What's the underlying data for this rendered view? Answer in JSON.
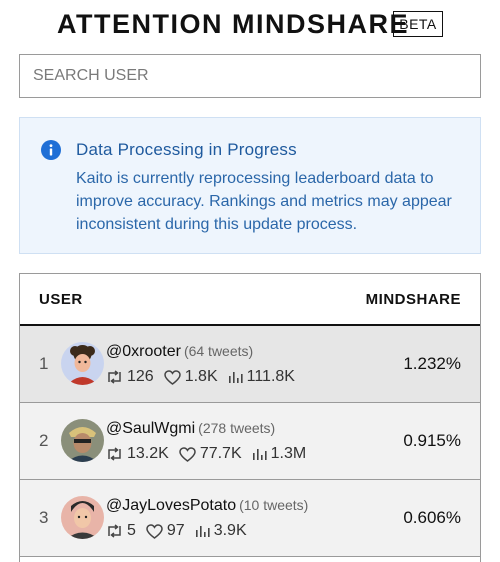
{
  "header": {
    "title": "ATTENTION MINDSHARE",
    "badge": "BETA"
  },
  "search": {
    "placeholder": "SEARCH USER",
    "value": ""
  },
  "notice": {
    "title": "Data Processing in Progress",
    "body": "Kaito is currently reprocessing leaderboard data to improve accuracy. Rankings and metrics may appear inconsistent during this update process.",
    "icon": "info-icon",
    "colors": {
      "background": "#eef5fd",
      "text": "#2b67a9"
    }
  },
  "table": {
    "columns": {
      "user": "USER",
      "mindshare": "MINDSHARE"
    },
    "rows": [
      {
        "rank": "1",
        "handle": "@0xrooter",
        "tweets": "(64 tweets)",
        "retweets": "126",
        "likes": "1.8K",
        "views": "111.8K",
        "mindshare": "1.232%"
      },
      {
        "rank": "2",
        "handle": "@SaulWgmi",
        "tweets": "(278 tweets)",
        "retweets": "13.2K",
        "likes": "77.7K",
        "views": "1.3M",
        "mindshare": "0.915%"
      },
      {
        "rank": "3",
        "handle": "@JayLovesPotato",
        "tweets": "(10 tweets)",
        "retweets": "5",
        "likes": "97",
        "views": "3.9K",
        "mindshare": "0.606%"
      }
    ]
  },
  "icons": {
    "retweet": "retweet-icon",
    "like": "heart-icon",
    "views": "views-icon"
  }
}
